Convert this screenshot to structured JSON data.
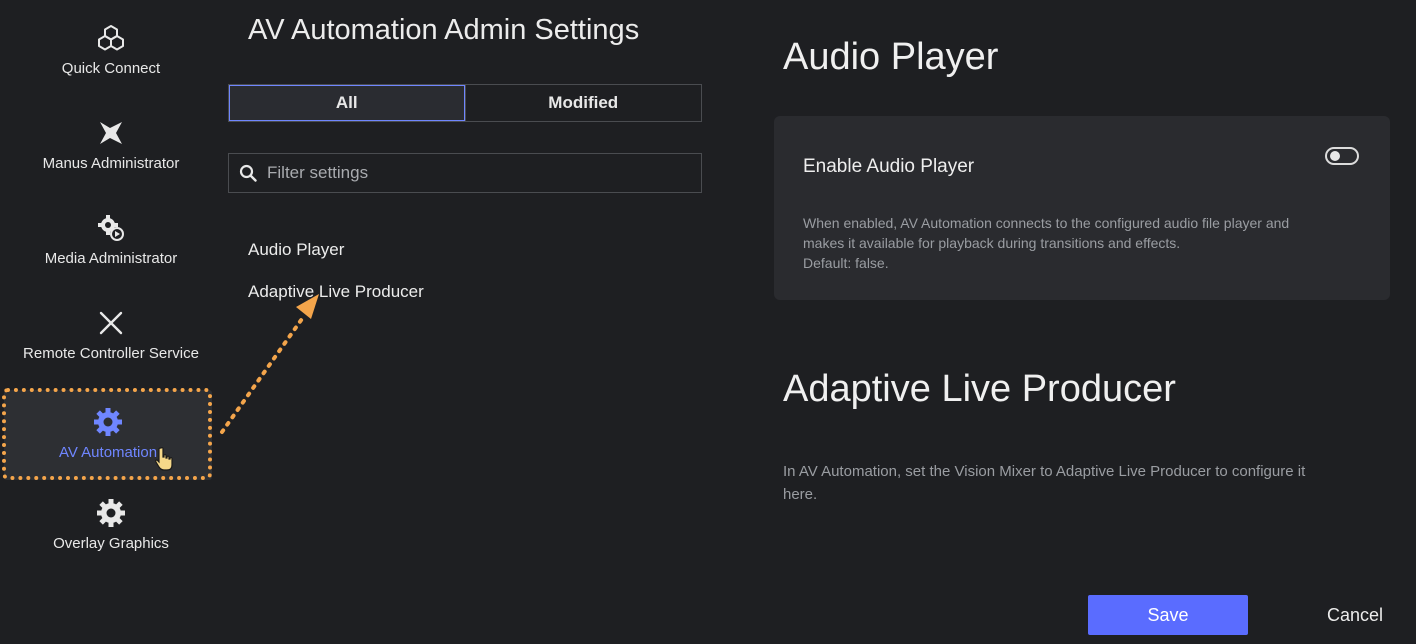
{
  "sidebar": {
    "items": [
      {
        "label": "Quick Connect",
        "icon": "cubes-icon"
      },
      {
        "label": "Manus Administrator",
        "icon": "manus-logo-icon"
      },
      {
        "label": "Media Administrator",
        "icon": "media-gear-icon"
      },
      {
        "label": "Remote Controller Service",
        "icon": "close-x-icon"
      },
      {
        "label": "AV Automation",
        "icon": "gear-icon",
        "active": true
      },
      {
        "label": "Overlay Graphics",
        "icon": "gear-icon"
      }
    ]
  },
  "settings": {
    "title": "AV Automation Admin Settings",
    "tabs": [
      {
        "label": "All",
        "active": true
      },
      {
        "label": "Modified"
      }
    ],
    "search": {
      "placeholder": "Filter settings",
      "value": ""
    },
    "links": [
      "Audio Player",
      "Adaptive Live Producer"
    ]
  },
  "content": {
    "audio_player": {
      "title": "Audio Player",
      "setting": {
        "title": "Enable Audio Player",
        "enabled": false,
        "desc_lines": [
          "When enabled, AV Automation connects to the configured audio file player and",
          "makes it available for playback during transitions and effects.",
          "Default: false."
        ]
      }
    },
    "adaptive_live_producer": {
      "title": "Adaptive Live Producer",
      "desc": "In AV Automation, set the Vision Mixer to Adaptive Live Producer to configure it here."
    }
  },
  "footer": {
    "save_label": "Save",
    "cancel_label": "Cancel"
  },
  "colors": {
    "background": "#1e1f22",
    "accent": "#5a6cff",
    "active_label": "#6f86ff",
    "annotation": "#f4a54b"
  }
}
